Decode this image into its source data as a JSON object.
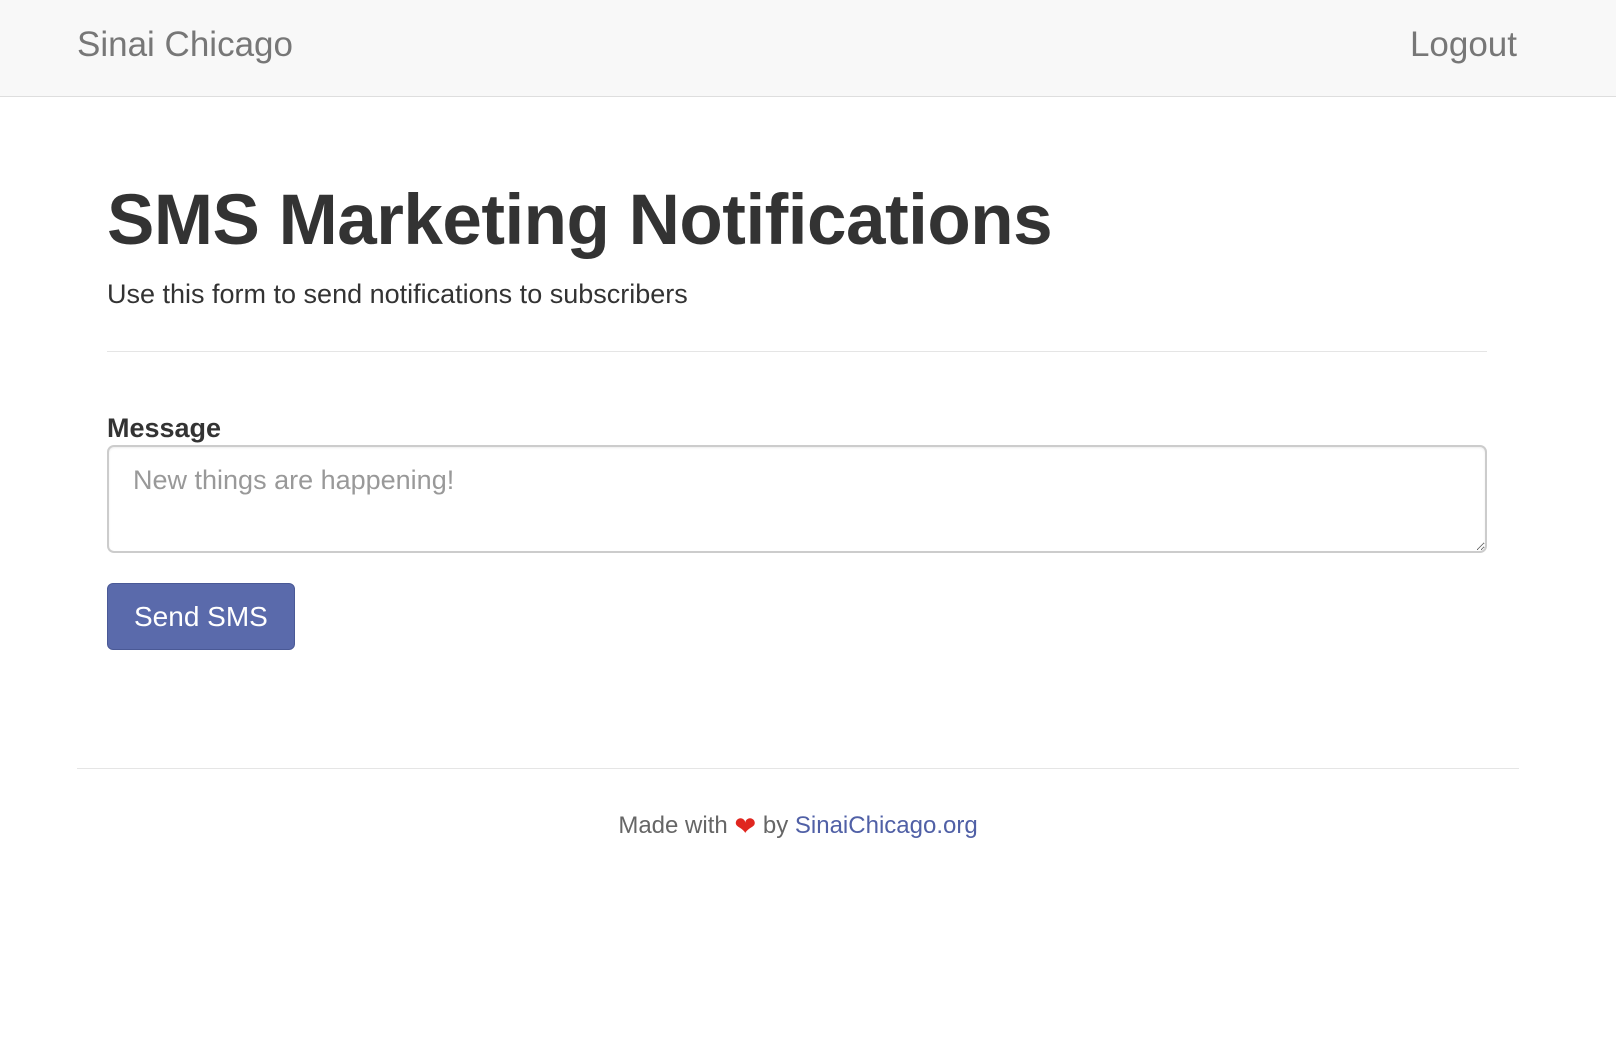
{
  "navbar": {
    "brand": "Sinai Chicago",
    "logout_label": "Logout"
  },
  "main": {
    "title": "SMS Marketing Notifications",
    "subtitle": "Use this form to send notifications to subscribers",
    "form": {
      "message_label": "Message",
      "message_value": "",
      "message_placeholder": "New things are happening!",
      "send_label": "Send SMS"
    }
  },
  "footer": {
    "made_with": "Made with",
    "heart_icon": "heart-icon",
    "by": "by",
    "link_text": "SinaiChicago.org"
  },
  "colors": {
    "navbar_bg": "#f8f8f8",
    "button": "#5a6aab",
    "heart": "#e0261f",
    "link": "#5060a6"
  }
}
